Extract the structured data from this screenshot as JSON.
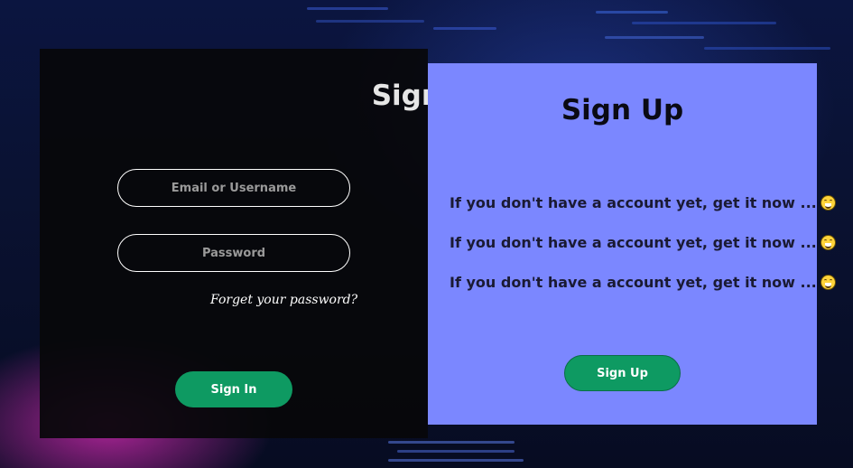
{
  "signin": {
    "title": "Sign In",
    "email_placeholder": "Email or Username",
    "password_placeholder": "Password",
    "forgot_label": "Forget your password?",
    "button_label": "Sign In"
  },
  "signup": {
    "title": "Sign Up",
    "messages": [
      "If you don't have a account yet, get it now ...",
      "If you don't have a account yet, get it now ...",
      "If you don't have a account yet, get it now ..."
    ],
    "message_icon": "grinning-face-icon",
    "button_label": "Sign Up"
  },
  "colors": {
    "signin_panel": "#08080A",
    "signup_panel": "#7B87FF",
    "button_green": "#0E9A62"
  }
}
